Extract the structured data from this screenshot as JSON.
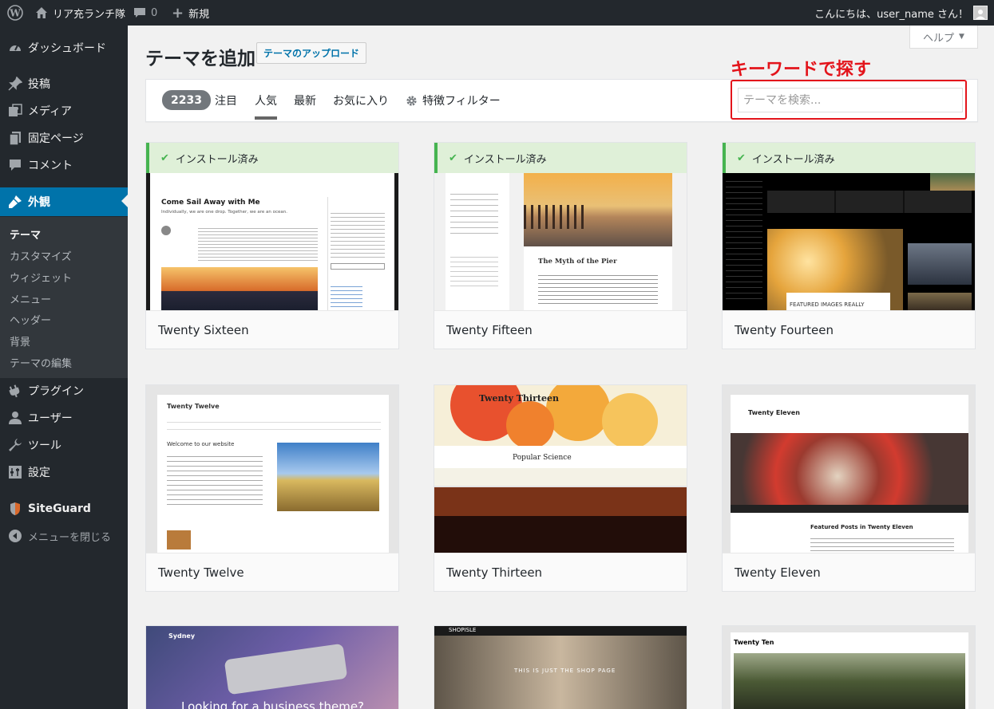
{
  "adminbar": {
    "site_name": "リア充ランチ隊",
    "comments_count": "0",
    "new_label": "新規",
    "greeting": "こんにちは、user_name さん！"
  },
  "sidebar": {
    "items": [
      {
        "label": "ダッシュボード",
        "icon": "dashboard-icon"
      },
      {
        "label": "投稿",
        "icon": "pin-icon"
      },
      {
        "label": "メディア",
        "icon": "media-icon"
      },
      {
        "label": "固定ページ",
        "icon": "pages-icon"
      },
      {
        "label": "コメント",
        "icon": "comment-icon"
      },
      {
        "label": "外観",
        "icon": "appearance-icon"
      },
      {
        "label": "プラグイン",
        "icon": "plugin-icon"
      },
      {
        "label": "ユーザー",
        "icon": "users-icon"
      },
      {
        "label": "ツール",
        "icon": "tools-icon"
      },
      {
        "label": "設定",
        "icon": "settings-icon"
      },
      {
        "label": "SiteGuard",
        "icon": "siteguard-icon"
      },
      {
        "label": "メニューを閉じる",
        "icon": "collapse-icon"
      }
    ],
    "submenu": [
      "テーマ",
      "カスタマイズ",
      "ウィジェット",
      "メニュー",
      "ヘッダー",
      "背景",
      "テーマの編集"
    ]
  },
  "main": {
    "title": "テーマを追加",
    "upload_label": "テーマのアップロード",
    "help_label": "ヘルプ",
    "annotation": "キーワードで探す",
    "filters": {
      "count": "2233",
      "tabs": [
        "注目",
        "人気",
        "最新",
        "お気に入り"
      ],
      "feature_filter": "特徴フィルター",
      "search_placeholder": "テーマを検索..."
    },
    "installed_label": "インストール済み",
    "themes": [
      "Twenty Sixteen",
      "Twenty Fifteen",
      "Twenty Fourteen",
      "Twenty Twelve",
      "Twenty Thirteen",
      "Twenty Eleven"
    ],
    "previews": {
      "sixteen": {
        "title": "Come Sail Away with Me",
        "tagline": "Individually, we are one drop. Together, we are an ocean."
      },
      "fifteen": {
        "title": "The Myth of the Pier"
      },
      "fourteen": {
        "caption": "FEATURED IMAGES REALLY"
      },
      "twelve": {
        "title": "Twenty Twelve",
        "heading": "Welcome to our website"
      },
      "thirteen": {
        "title": "Twenty Thirteen",
        "heading": "Popular Science"
      },
      "eleven": {
        "title": "Twenty Eleven",
        "heading": "Featured Posts in Twenty Eleven"
      },
      "sydney": {
        "brand": "Sydney",
        "headline": "Looking for a business theme?"
      },
      "shop": {
        "brand": "SHOPISLE",
        "text": "THIS IS JUST THE SHOP PAGE"
      },
      "ten": {
        "title": "Twenty Ten"
      }
    }
  },
  "colors": {
    "admin_dark": "#23282d",
    "accent": "#0073aa",
    "installed_green": "#46b450",
    "annotation_red": "#e3141b"
  }
}
